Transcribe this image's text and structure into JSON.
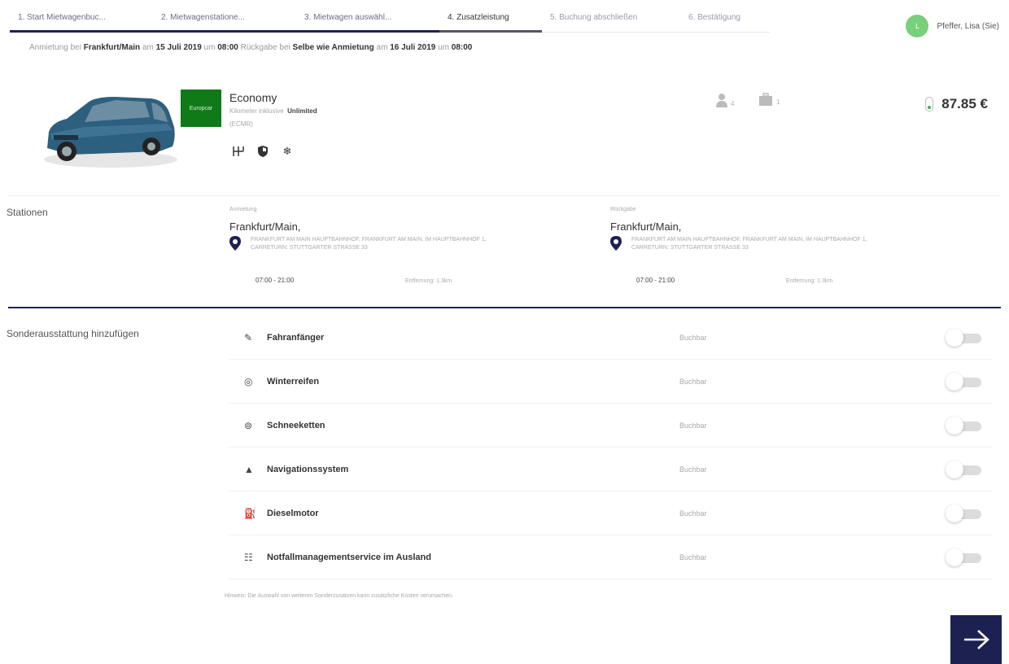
{
  "steps": [
    {
      "label": "1. Start Mietwagenbuc...",
      "state": "done"
    },
    {
      "label": "2. Mietwagenstatione...",
      "state": "done"
    },
    {
      "label": "3. Mietwagen auswähl...",
      "state": "done"
    },
    {
      "label": "4. Zusatzleistung",
      "state": "active"
    },
    {
      "label": "5. Buchung abschließen",
      "state": "todo"
    },
    {
      "label": "6. Bestätigung",
      "state": "todo"
    }
  ],
  "user": {
    "initial": "L",
    "name": "Pfeffer, Lisa (Sie)"
  },
  "summary": {
    "t1": "Anmietung bei ",
    "pickup_city": "Frankfurt/Main",
    "t2": " am ",
    "pickup_date": "15 Juli 2019",
    "t3": " um ",
    "pickup_time": "08:00",
    "t4": " Rückgabe bei ",
    "return_place": "Selbe wie Anmietung",
    "t5": " am ",
    "return_date": "16 Juli 2019",
    "t6": " um ",
    "return_time": "08:00"
  },
  "vehicle": {
    "brand": "Europcar",
    "category": "Economy",
    "km_label": "Kilometer inklusive",
    "km_value": "Unlimited",
    "code": "(ECMR)",
    "feature_icons": [
      "gearbox-icon",
      "shield-icon",
      "air-conditioning-icon"
    ],
    "passengers": "4",
    "luggage": "1",
    "price": "87.85 €"
  },
  "stations": {
    "title": "Stationen",
    "pickup": {
      "label": "Anmietung",
      "city": "Frankfurt/Main,",
      "address": "FRANKFURT AM MAIN HAUPTBAHNHOF, FRANKFURT AM MAIN, IM HAUPTBAHNHOF 1, CARRETURN: STUTTGARTER STRASSE 33",
      "hours": "07:00 - 21:00",
      "distance": "Entfernung: 1.3km"
    },
    "return": {
      "label": "Rückgabe",
      "city": "Frankfurt/Main,",
      "address": "FRANKFURT AM MAIN HAUPTBAHNHOF, FRANKFURT AM MAIN, IM HAUPTBAHNHOF 1, CARRETURN: STUTTGARTER STRASSE 33",
      "hours": "07:00 - 21:00",
      "distance": "Entfernung: 1.3km"
    }
  },
  "extras": {
    "title": "Sonderausstattung hinzufügen",
    "items": [
      {
        "name": "Fahranfänger",
        "status": "Buchbar",
        "icon": "novice-driver-icon",
        "on": false
      },
      {
        "name": "Winterreifen",
        "status": "Buchbar",
        "icon": "winter-tire-icon",
        "on": false
      },
      {
        "name": "Schneeketten",
        "status": "Buchbar",
        "icon": "snow-chain-icon",
        "on": false
      },
      {
        "name": "Navigationssystem",
        "status": "Buchbar",
        "icon": "navigation-icon",
        "on": false
      },
      {
        "name": "Dieselmotor",
        "status": "Buchbar",
        "icon": "diesel-pump-icon",
        "on": false
      },
      {
        "name": "Notfallmanagementservice im Ausland",
        "status": "Buchbar",
        "icon": "emergency-service-icon",
        "on": false
      }
    ],
    "hint": "Hinweis: Die Auswahl von weiteren Sonderzusatzen kann zusätzliche Kosten verursachen."
  },
  "colors": {
    "primary": "#1d2152",
    "brand_green": "#0f7a17",
    "avatar": "#78d07a"
  }
}
